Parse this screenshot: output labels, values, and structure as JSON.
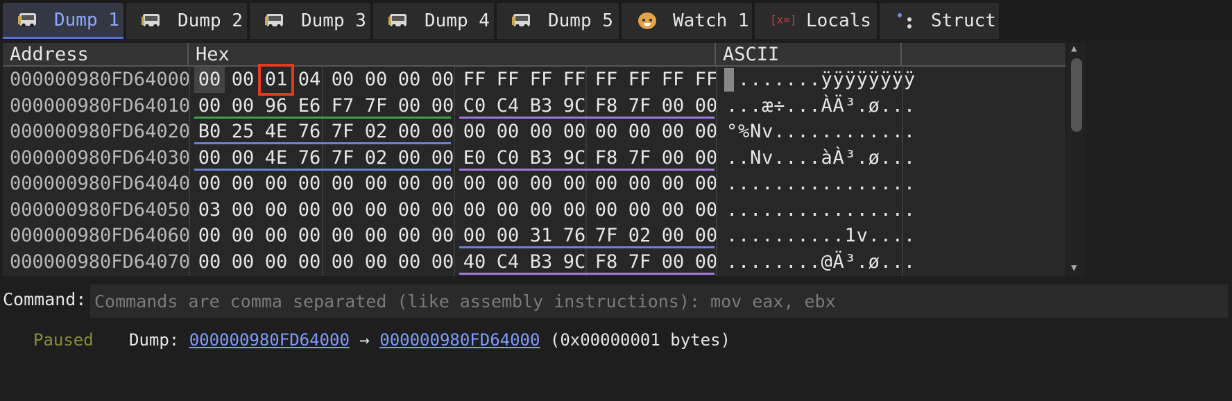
{
  "tabs": [
    {
      "label": "Dump 1",
      "icon": "bus-icon",
      "active": true
    },
    {
      "label": "Dump 2",
      "icon": "bus-icon",
      "active": false
    },
    {
      "label": "Dump 3",
      "icon": "bus-icon",
      "active": false
    },
    {
      "label": "Dump 4",
      "icon": "bus-icon",
      "active": false
    },
    {
      "label": "Dump 5",
      "icon": "bus-icon",
      "active": false
    },
    {
      "label": "Watch 1",
      "icon": "cat-icon",
      "active": false
    },
    {
      "label": "Locals",
      "icon": "variable-icon",
      "active": false
    },
    {
      "label": "Struct",
      "icon": "struct-icon",
      "active": false
    }
  ],
  "dump": {
    "headers": {
      "address": "Address",
      "hex": "Hex",
      "ascii": "ASCII"
    },
    "rows": [
      {
        "address": "000000980FD64000",
        "bytes": [
          "00",
          "00",
          "01",
          "04",
          "00",
          "00",
          "00",
          "00",
          "FF",
          "FF",
          "FF",
          "FF",
          "FF",
          "FF",
          "FF",
          "FF"
        ],
        "ascii": "........ÿÿÿÿÿÿÿÿ"
      },
      {
        "address": "000000980FD64010",
        "bytes": [
          "00",
          "00",
          "96",
          "E6",
          "F7",
          "7F",
          "00",
          "00",
          "C0",
          "C4",
          "B3",
          "9C",
          "F8",
          "7F",
          "00",
          "00"
        ],
        "ascii": "...æ÷...ÀÄ³.ø..."
      },
      {
        "address": "000000980FD64020",
        "bytes": [
          "B0",
          "25",
          "4E",
          "76",
          "7F",
          "02",
          "00",
          "00",
          "00",
          "00",
          "00",
          "00",
          "00",
          "00",
          "00",
          "00"
        ],
        "ascii": "°%Nv............"
      },
      {
        "address": "000000980FD64030",
        "bytes": [
          "00",
          "00",
          "4E",
          "76",
          "7F",
          "02",
          "00",
          "00",
          "E0",
          "C0",
          "B3",
          "9C",
          "F8",
          "7F",
          "00",
          "00"
        ],
        "ascii": "..Nv....àÀ³.ø..."
      },
      {
        "address": "000000980FD64040",
        "bytes": [
          "00",
          "00",
          "00",
          "00",
          "00",
          "00",
          "00",
          "00",
          "00",
          "00",
          "00",
          "00",
          "00",
          "00",
          "00",
          "00"
        ],
        "ascii": "................"
      },
      {
        "address": "000000980FD64050",
        "bytes": [
          "03",
          "00",
          "00",
          "00",
          "00",
          "00",
          "00",
          "00",
          "00",
          "00",
          "00",
          "00",
          "00",
          "00",
          "00",
          "00"
        ],
        "ascii": "................"
      },
      {
        "address": "000000980FD64060",
        "bytes": [
          "00",
          "00",
          "00",
          "00",
          "00",
          "00",
          "00",
          "00",
          "00",
          "00",
          "31",
          "76",
          "7F",
          "02",
          "00",
          "00"
        ],
        "ascii": "..........1v...."
      },
      {
        "address": "000000980FD64070",
        "bytes": [
          "00",
          "00",
          "00",
          "00",
          "00",
          "00",
          "00",
          "00",
          "40",
          "C4",
          "B3",
          "9C",
          "F8",
          "7F",
          "00",
          "00"
        ],
        "ascii": "........@Ä³.ø..."
      }
    ],
    "selected_byte": {
      "row": 0,
      "col": 2
    }
  },
  "colors": {
    "underline_green": "#3fa34a",
    "underline_blue": "#6f7fe0",
    "underline_purple": "#a07ae0",
    "selection_box": "#e53a22",
    "link": "#7f9bff",
    "paused": "#8a8a3a"
  },
  "command": {
    "label": "Command:",
    "placeholder": "Commands are comma separated (like assembly instructions): mov eax, ebx",
    "value": ""
  },
  "status": {
    "state": "Paused",
    "prefix": "Dump: ",
    "start": "000000980FD64000",
    "arrow": " → ",
    "end": "000000980FD64000",
    "size": " (0x00000001 bytes)"
  }
}
